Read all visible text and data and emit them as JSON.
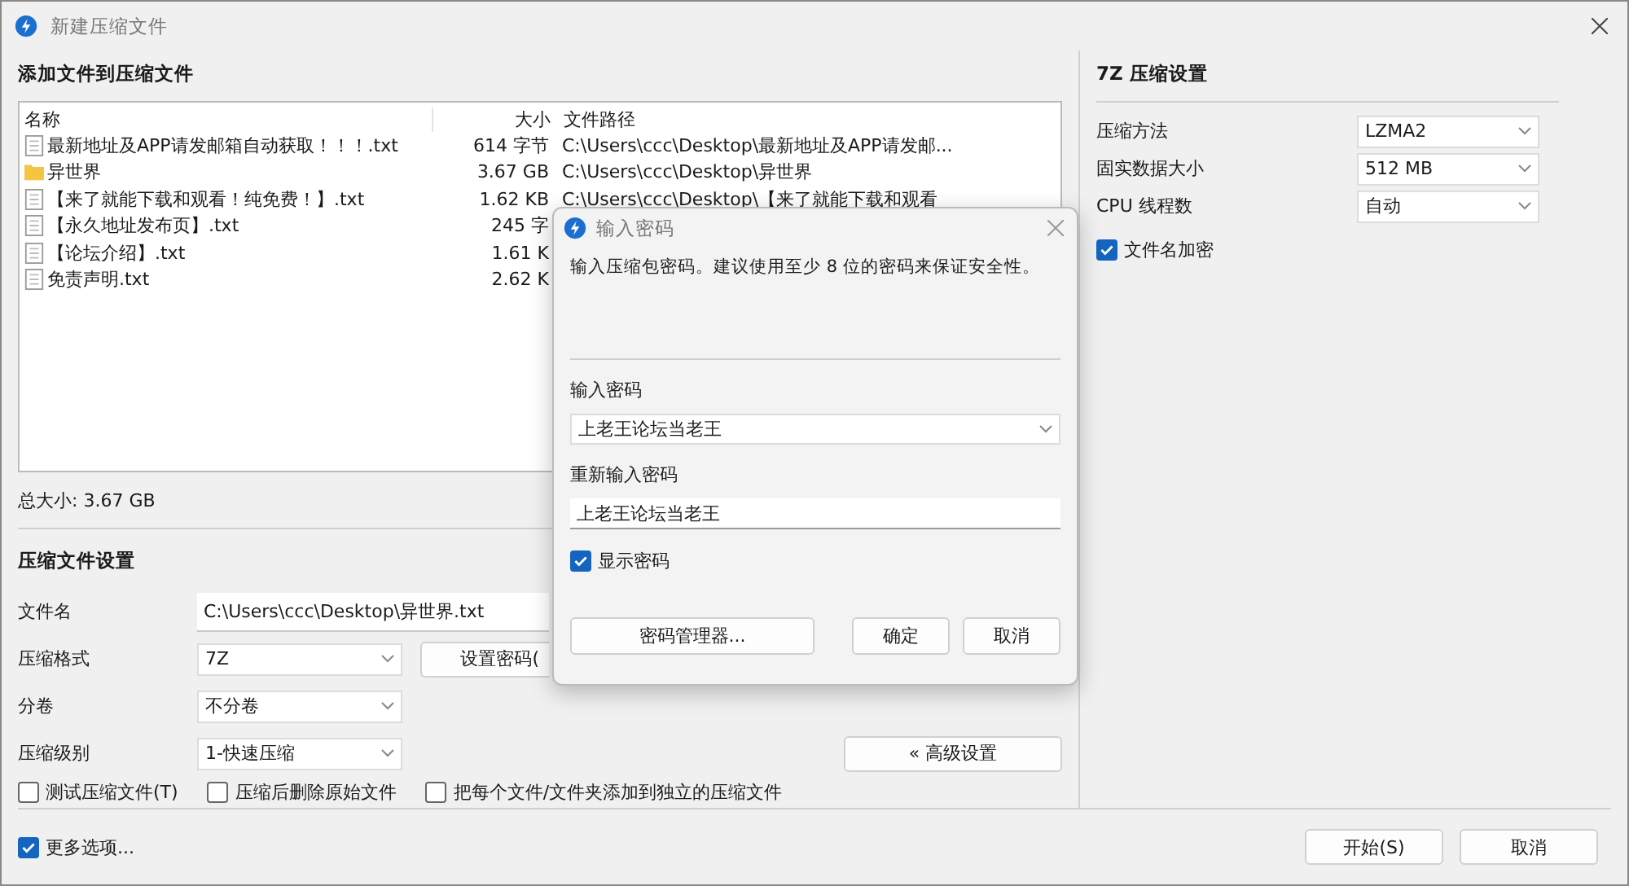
{
  "window": {
    "title": "新建压缩文件"
  },
  "files_section": {
    "title": "添加文件到压缩文件",
    "columns": [
      "名称",
      "大小",
      "文件路径"
    ],
    "rows": [
      {
        "kind": "file",
        "name": "最新地址及APP请发邮箱自动获取！！！.txt",
        "size": "614 字节",
        "path": "C:\\Users\\ccc\\Desktop\\最新地址及APP请发邮..."
      },
      {
        "kind": "folder",
        "name": "异世界",
        "size": "3.67 GB",
        "path": "C:\\Users\\ccc\\Desktop\\异世界"
      },
      {
        "kind": "file",
        "name": "【来了就能下载和观看！纯免费！】.txt",
        "size": "1.62 KB",
        "path": "C:\\Users\\ccc\\Desktop\\【来了就能下载和观看"
      },
      {
        "kind": "file",
        "name": "【永久地址发布页】.txt",
        "size": "245 字"
      },
      {
        "kind": "file",
        "name": "【论坛介绍】.txt",
        "size": "1.61 K"
      },
      {
        "kind": "file",
        "name": "免责声明.txt",
        "size": "2.62 K"
      }
    ],
    "total": "总大小: 3.67 GB"
  },
  "settings": {
    "title": "压缩文件设置",
    "fields": [
      {
        "label": "文件名",
        "kind": "text",
        "value": "C:\\Users\\ccc\\Desktop\\异世界.txt"
      },
      {
        "label": "压缩格式",
        "kind": "dropdown",
        "value": "7Z"
      },
      {
        "label": "分卷",
        "kind": "dropdown",
        "value": "不分卷"
      },
      {
        "label": "压缩级别",
        "kind": "dropdown",
        "value": "1-快速压缩"
      }
    ],
    "password_button": "设置密码(",
    "advanced_button": "« 高级设置",
    "options": [
      {
        "label": "测试压缩文件(T)",
        "checked": false
      },
      {
        "label": "压缩后删除原始文件",
        "checked": false
      },
      {
        "label": "把每个文件/文件夹添加到独立的压缩文件",
        "checked": false
      }
    ]
  },
  "advanced": {
    "title": "7Z 压缩设置",
    "fields": [
      {
        "label": "压缩方法",
        "value": "LZMA2"
      },
      {
        "label": "固实数据大小",
        "value": "512 MB"
      },
      {
        "label": "CPU 线程数",
        "value": "自动"
      }
    ],
    "encrypt_names": {
      "label": "文件名加密",
      "checked": true
    }
  },
  "more_options": {
    "label": "更多选项...",
    "checked": true
  },
  "buttons": [
    "开始(S)",
    "取消"
  ],
  "dialog": {
    "title": "输入密码",
    "message": "输入压缩包密码。建议使用至少 8 位的密码来保证安全性。",
    "password_label": "输入密码",
    "password": "上老王论坛当老王",
    "confirm_label": "重新输入密码",
    "confirm": "上老王论坛当老王",
    "show_password": {
      "label": "显示密码",
      "checked": true
    },
    "buttons": [
      "密码管理器...",
      "确定",
      "取消"
    ]
  }
}
